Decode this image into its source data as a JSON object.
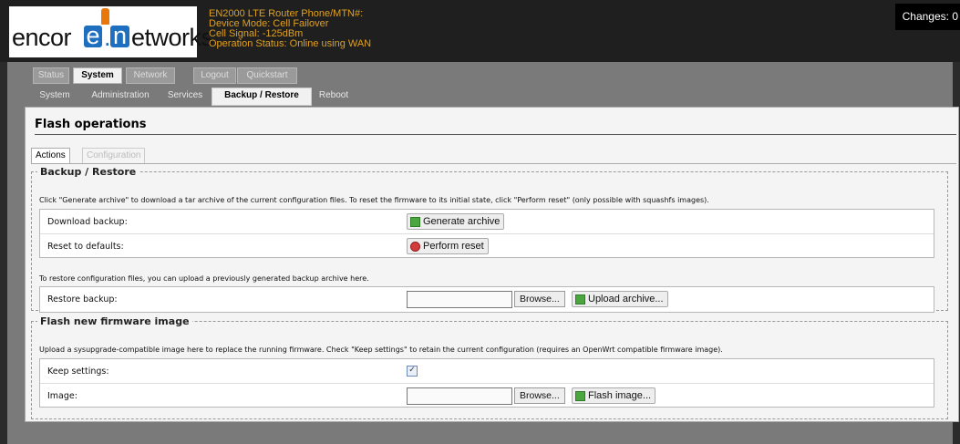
{
  "logo": {
    "pre": "encor",
    "e1": "e",
    "dot": ".",
    "n": "n",
    "post": "etworks"
  },
  "header": {
    "line1": "EN2000 LTE Router Phone/MTN#:",
    "line2": "Device Mode: Cell Failover",
    "line3": "Cell Signal: -125dBm",
    "line4": "Operation Status: Online using WAN",
    "changes": "Changes: 0"
  },
  "nav": {
    "main": [
      "Status",
      "System",
      "Network",
      "Logout",
      "Quickstart"
    ],
    "active_main": "System",
    "sub": [
      "System",
      "Administration",
      "Services",
      "Backup / Restore",
      "Reboot"
    ],
    "active_sub": "Backup / Restore"
  },
  "page": {
    "title": "Flash operations",
    "tabs": [
      "Actions",
      "Configuration"
    ]
  },
  "backup": {
    "legend": "Backup / Restore",
    "description": "Click \"Generate archive\" to download a tar archive of the current configuration files. To reset the firmware to its initial state, click \"Perform reset\" (only possible with squashfs images).",
    "download_label": "Download backup:",
    "generate_button": "Generate archive",
    "reset_label": "Reset to defaults:",
    "reset_button": "Perform reset",
    "restore_desc": "To restore configuration files, you can upload a previously generated backup archive here.",
    "restore_label": "Restore backup:",
    "browse": "Browse...",
    "upload_button": "Upload archive..."
  },
  "flash": {
    "legend": "Flash new firmware image",
    "description": "Upload a sysupgrade-compatible image here to replace the running firmware. Check \"Keep settings\" to retain the current configuration (requires an OpenWrt compatible firmware image).",
    "keep_label": "Keep settings:",
    "keep_checked": true,
    "image_label": "Image:",
    "browse": "Browse...",
    "flash_button": "Flash image..."
  },
  "colors": {
    "accent": "#1f6fc0",
    "header_text": "#e0a020",
    "bang": "#e8780c"
  }
}
